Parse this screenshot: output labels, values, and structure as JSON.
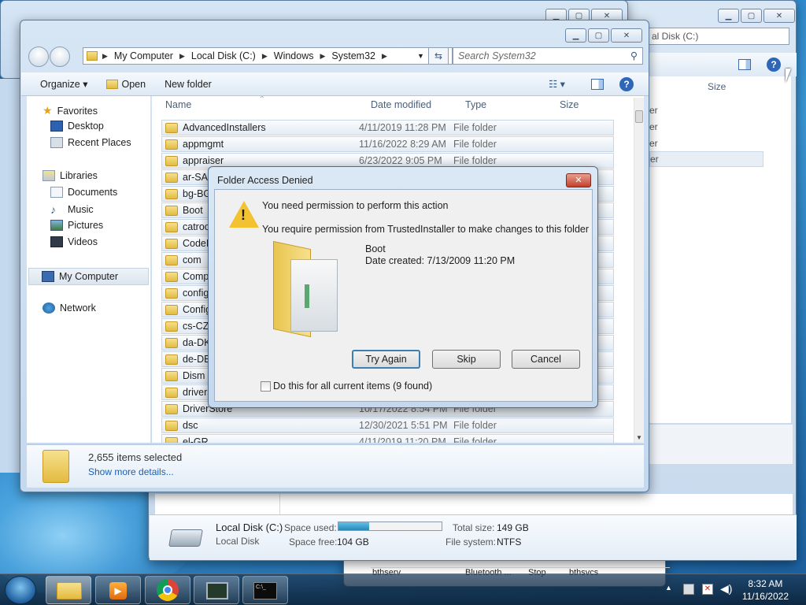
{
  "main_window": {
    "breadcrumb": [
      "My Computer",
      "Local Disk (C:)",
      "Windows",
      "System32"
    ],
    "search_placeholder": "Search System32",
    "toolbar": {
      "organize": "Organize",
      "open": "Open",
      "new_folder": "New folder"
    },
    "nav": {
      "favorites": "Favorites",
      "desktop": "Desktop",
      "recent": "Recent Places",
      "libraries": "Libraries",
      "documents": "Documents",
      "music": "Music",
      "pictures": "Pictures",
      "videos": "Videos",
      "computer": "My Computer",
      "network": "Network"
    },
    "columns": {
      "name": "Name",
      "date": "Date modified",
      "type": "Type",
      "size": "Size"
    },
    "rows": [
      {
        "name": "AdvancedInstallers",
        "date": "4/11/2019 11:28 PM",
        "type": "File folder"
      },
      {
        "name": "appmgmt",
        "date": "11/16/2022 8:29 AM",
        "type": "File folder"
      },
      {
        "name": "appraiser",
        "date": "6/23/2022 9:05 PM",
        "type": "File folder"
      },
      {
        "name": "ar-SA",
        "date": "",
        "type": ""
      },
      {
        "name": "bg-BG",
        "date": "",
        "type": ""
      },
      {
        "name": "Boot",
        "date": "",
        "type": ""
      },
      {
        "name": "catroo",
        "date": "",
        "type": ""
      },
      {
        "name": "CodeI",
        "date": "",
        "type": ""
      },
      {
        "name": "com",
        "date": "",
        "type": ""
      },
      {
        "name": "Comp",
        "date": "",
        "type": ""
      },
      {
        "name": "config",
        "date": "",
        "type": ""
      },
      {
        "name": "Config",
        "date": "",
        "type": ""
      },
      {
        "name": "cs-CZ",
        "date": "",
        "type": ""
      },
      {
        "name": "da-DK",
        "date": "",
        "type": ""
      },
      {
        "name": "de-DE",
        "date": "",
        "type": ""
      },
      {
        "name": "Dism",
        "date": "",
        "type": ""
      },
      {
        "name": "drivers",
        "date": "",
        "type": ""
      },
      {
        "name": "DriverStore",
        "date": "10/17/2022 8:54 PM",
        "type": "File folder"
      },
      {
        "name": "dsc",
        "date": "12/30/2021 5:51 PM",
        "type": "File folder"
      },
      {
        "name": "el-GR",
        "date": "4/11/2019 11:20 PM",
        "type": "File folder"
      }
    ],
    "details": {
      "count": "2,655 items selected",
      "more": "Show more details..."
    }
  },
  "dialog": {
    "title": "Folder Access Denied",
    "heading": "You need permission to perform this action",
    "message": "You require permission from TrustedInstaller to make changes to this folder",
    "item_name": "Boot",
    "item_date": "Date created: 7/13/2009 11:20 PM",
    "try_again": "Try Again",
    "skip": "Skip",
    "cancel": "Cancel",
    "checkbox": "Do this for all current items (9 found)"
  },
  "back_window": {
    "search_partial": "al Disk (C:)",
    "size_col": "Size",
    "partial_rows": [
      "er",
      "er",
      "er",
      "er"
    ],
    "disk": {
      "name": "Local Disk (C:)",
      "type": "Local Disk",
      "used_label": "Space used:",
      "free_label": "Space free:",
      "free": "104 GB",
      "total_label": "Total size:",
      "total": "149 GB",
      "fs_label": "File system:",
      "fs": "NTFS",
      "used_fraction": 0.3
    }
  },
  "bottom_window": {
    "cells": [
      "bthserv",
      "Bluetooth ...",
      "Stop",
      "bthsvcs"
    ]
  },
  "taskbar": {
    "time": "8:32 AM",
    "date": "11/16/2022"
  }
}
